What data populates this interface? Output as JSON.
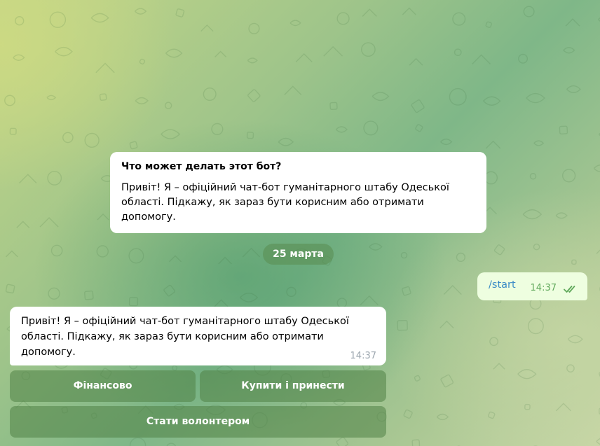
{
  "info_card": {
    "title": "Что может делать этот бот?",
    "text": "Привіт! Я – офіційний чат-бот гуманітарного штабу Одеської області. Підкажу, як зараз бути корисним або отримати допомогу."
  },
  "date_separator": "25 марта",
  "outgoing_message": {
    "text": "/start",
    "time": "14:37",
    "status_icon": "double-check-icon"
  },
  "incoming_message": {
    "text": "Привіт! Я – офіційний чат-бот гуманітарного штабу Одеської області. Підкажу, як зараз бути корисним або отримати допомогу.",
    "time": "14:37"
  },
  "keyboard": {
    "finance": "Фінансово",
    "buy_and_bring": "Купити і принести",
    "volunteer": "Стати волонтером"
  },
  "colors": {
    "outgoing_bubble": "#eefee0",
    "link": "#3a8bc6",
    "read_check": "#5fa85a"
  }
}
